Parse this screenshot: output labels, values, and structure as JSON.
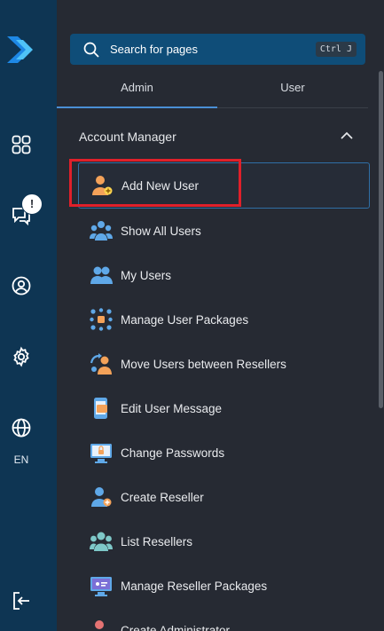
{
  "search": {
    "placeholder": "Search for pages",
    "shortcut": "Ctrl J"
  },
  "tabs": [
    {
      "label": "Admin",
      "active": true
    },
    {
      "label": "User",
      "active": false
    }
  ],
  "rail": {
    "notification_badge": "!",
    "language": "EN"
  },
  "section": {
    "title": "Account Manager",
    "expanded": true
  },
  "menu": [
    {
      "label": "Add New User",
      "icon": "add-user-icon",
      "active": true
    },
    {
      "label": "Show All Users",
      "icon": "users-group-icon"
    },
    {
      "label": "My Users",
      "icon": "my-users-icon"
    },
    {
      "label": "Manage User Packages",
      "icon": "user-packages-icon"
    },
    {
      "label": "Move Users between Resellers",
      "icon": "move-users-icon"
    },
    {
      "label": "Edit User Message",
      "icon": "user-message-icon"
    },
    {
      "label": "Change Passwords",
      "icon": "change-password-icon"
    },
    {
      "label": "Create Reseller",
      "icon": "create-reseller-icon"
    },
    {
      "label": "List Resellers",
      "icon": "list-resellers-icon"
    },
    {
      "label": "Manage Reseller Packages",
      "icon": "reseller-packages-icon"
    },
    {
      "label": "Create Administrator",
      "icon": "create-admin-icon"
    }
  ],
  "colors": {
    "rail": "#0e3553",
    "panel": "#262a33",
    "accent": "#4a8fd6",
    "search_bg": "#0f4d78",
    "highlight": "#e0202a"
  }
}
